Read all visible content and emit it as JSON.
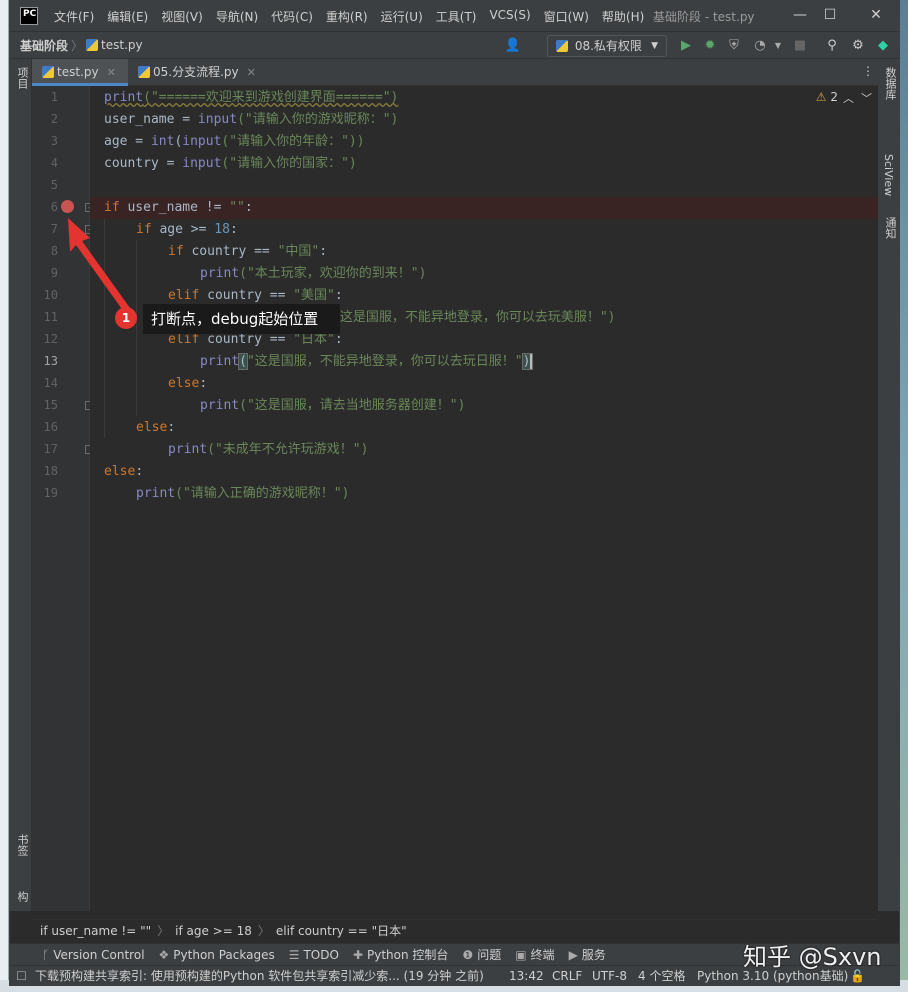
{
  "window": {
    "title": "基础阶段 - test.py",
    "logo": "PC",
    "menu": [
      "文件(F)",
      "编辑(E)",
      "视图(V)",
      "导航(N)",
      "代码(C)",
      "重构(R)",
      "运行(U)",
      "工具(T)",
      "VCS(S)",
      "窗口(W)",
      "帮助(H)"
    ],
    "controls": {
      "minimize": "—",
      "maximize": "☐",
      "close": "✕"
    }
  },
  "navbar": {
    "project": "基础阶段",
    "file": "test.py",
    "run_config": "08.私有权限",
    "run_config_arrow": "▼"
  },
  "tabs": [
    {
      "label": "test.py",
      "active": true
    },
    {
      "label": "05.分支流程.py",
      "active": false
    }
  ],
  "left_strip": {
    "project": "项目",
    "bookmarks": "书签",
    "structure": "结构"
  },
  "right_strip": {
    "database": "数据库",
    "sciview": "SciView",
    "notifications": "通知"
  },
  "inspection": {
    "warnings": "2"
  },
  "line_numbers": [
    "1",
    "2",
    "3",
    "4",
    "5",
    "6",
    "7",
    "8",
    "9",
    "10",
    "11",
    "12",
    "13",
    "14",
    "15",
    "16",
    "17",
    "18",
    "19"
  ],
  "current_line": "13",
  "code": {
    "l1": {
      "fn": "print",
      "str": "(\"======欢迎来到游戏创建界面======\")"
    },
    "l2": {
      "var": "user_name = ",
      "fn": "input",
      "str": "(\"请输入你的游戏昵称：\")"
    },
    "l3": {
      "pre": "age = ",
      "fn1": "int",
      "mid": "(",
      "fn2": "input",
      "str": "(\"请输入你的年龄：\"))"
    },
    "l4": {
      "pre": "country = ",
      "fn": "input",
      "str": "(\"请输入你的国家：\")"
    },
    "l6": {
      "kw": "if",
      "rest": " user_name != ",
      "str": "\"\"",
      "end": ":"
    },
    "l7": {
      "kw": "if",
      "rest": " age >= ",
      "num": "18",
      "end": ":"
    },
    "l8": {
      "kw": "if",
      "rest": " country == ",
      "str": "\"中国\"",
      "end": ":"
    },
    "l9": {
      "fn": "print",
      "str": "(\"本土玩家，欢迎你的到来！\")"
    },
    "l10": {
      "kw": "elif",
      "rest": " country == ",
      "str": "\"美国\"",
      "end": ":"
    },
    "l11": {
      "str": "\"这是国服，不能异地登录，你可以去玩美服！\")"
    },
    "l12": {
      "kw": "elif",
      "rest": " country == ",
      "str": "\"日本\"",
      "end": ":"
    },
    "l13": {
      "fn": "print",
      "paren": "(",
      "str": "\"这是国服，不能异地登录，你可以去玩日服！\"",
      "close": ")"
    },
    "l14": {
      "kw": "else",
      "end": ":"
    },
    "l15": {
      "fn": "print",
      "str": "(\"这是国服，请去当地服务器创建！\")"
    },
    "l16": {
      "kw": "else",
      "end": ":"
    },
    "l17": {
      "fn": "print",
      "str": "(\"未成年不允许玩游戏！\")"
    },
    "l18": {
      "kw": "else",
      "end": ":"
    },
    "l19": {
      "fn": "print",
      "str": "(\"请输入正确的游戏昵称！\")"
    }
  },
  "annotation": {
    "badge": "1",
    "text": "打断点，debug起始位置"
  },
  "code_breadcrumb": [
    "if user_name != \"\"",
    "if age >= 18",
    "elif country == \"日本\""
  ],
  "tool_windows": [
    "Version Control",
    "Python Packages",
    "TODO",
    "Python 控制台",
    "问题",
    "终端",
    "服务"
  ],
  "status": {
    "message": "下载预构建共享索引: 使用预构建的Python 软件包共享索引减少索... (19 分钟 之前)",
    "position": "13:42",
    "line_ending": "CRLF",
    "encoding": "UTF-8",
    "indent": "4 个空格",
    "interpreter": "Python 3.10 (python基础)"
  },
  "watermark": "知乎 @Sxvn"
}
